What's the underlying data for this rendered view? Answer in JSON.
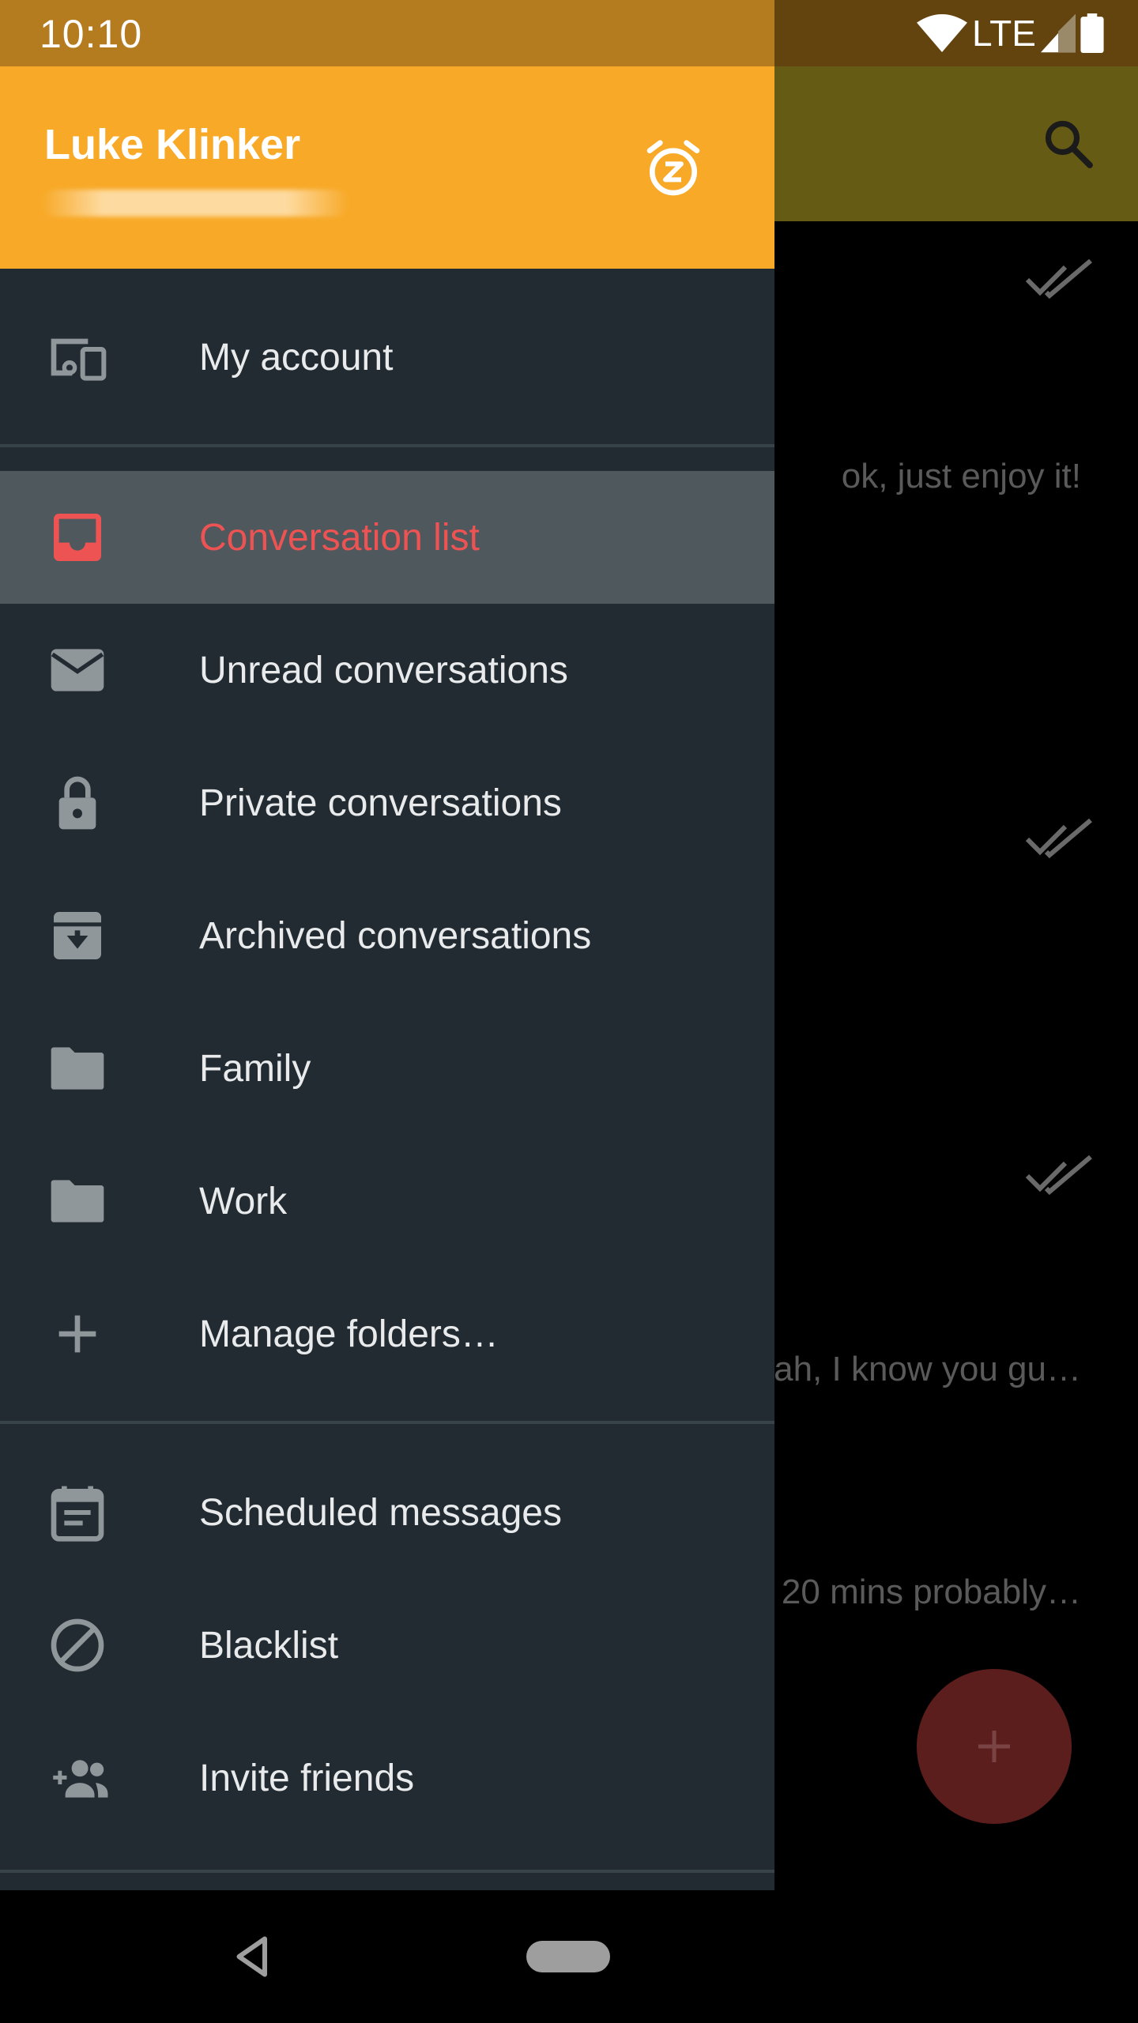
{
  "status_bar": {
    "time": "10:10",
    "network": "LTE"
  },
  "drawer": {
    "user_name": "Luke Klinker",
    "header_icon": "snooze-icon",
    "account_item": {
      "label": "My account",
      "icon": "devices-icon"
    },
    "items": [
      {
        "label": "Conversation list",
        "icon": "inbox-icon",
        "selected": true
      },
      {
        "label": "Unread conversations",
        "icon": "mail-icon"
      },
      {
        "label": "Private conversations",
        "icon": "lock-icon"
      },
      {
        "label": "Archived conversations",
        "icon": "archive-icon"
      },
      {
        "label": "Family",
        "icon": "folder-icon"
      },
      {
        "label": "Work",
        "icon": "folder-icon"
      },
      {
        "label": "Manage folders…",
        "icon": "plus-icon"
      }
    ],
    "bottom_items": [
      {
        "label": "Scheduled messages",
        "icon": "calendar-icon"
      },
      {
        "label": "Blacklist",
        "icon": "block-icon"
      },
      {
        "label": "Invite friends",
        "icon": "add-people-icon"
      }
    ],
    "colors": {
      "header": "#f8a927",
      "selected_text": "#ee5353",
      "background": "#212b31"
    }
  },
  "background_list": {
    "snippets": [
      "ok, just enjoy it!",
      "ah, I know you gu…",
      "20 mins probably…"
    ]
  }
}
